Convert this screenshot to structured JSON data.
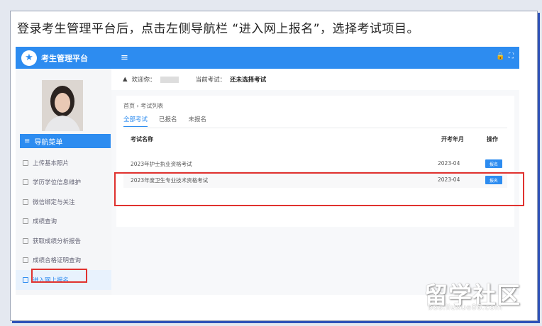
{
  "caption": "登录考生管理平台后，点击左侧导航栏 “进入网上报名”，选择考试项目。",
  "app": {
    "brand_title": "考生管理平台",
    "logo_glyph": "★",
    "menu_icon": "≡"
  },
  "topbar_icons": [
    "lock-icon",
    "expand-icon",
    "user-icon"
  ],
  "sidebar": {
    "nav_header": "导航菜单",
    "items": [
      {
        "label": "上传基本照片",
        "icon": "image-icon"
      },
      {
        "label": "学历学位信息维护",
        "icon": "doc-icon"
      },
      {
        "label": "微信绑定与关注",
        "icon": "link-icon"
      },
      {
        "label": "成绩查询",
        "icon": "search-icon"
      },
      {
        "label": "获取成绩分析报告",
        "icon": "report-icon"
      },
      {
        "label": "成绩合格证明查询",
        "icon": "file-icon"
      },
      {
        "label": "进入网上报名",
        "icon": "arrow-icon",
        "active": true
      }
    ]
  },
  "welcome": {
    "greeting": "欢迎你：",
    "current_exam_label": "当前考试：",
    "current_exam_value": "还未选择考试"
  },
  "breadcrumb": {
    "home": "首页",
    "sep": "›",
    "current": "考试列表"
  },
  "tabs": [
    "全部考试",
    "已报名",
    "未报名"
  ],
  "table": {
    "headers": {
      "name": "考试名称",
      "date": "开考年月",
      "op": "操作"
    },
    "rows": [
      {
        "name": "2023年护士执业资格考试",
        "date": "2023-04",
        "op": "报名"
      },
      {
        "name": "2023年度卫生专业技术资格考试",
        "date": "2023-04",
        "op": "报名"
      }
    ]
  },
  "watermark": {
    "text": "留学社区",
    "url": "bbs.liuxue86.com"
  },
  "colors": {
    "accent": "#2d8cf0",
    "highlight": "#e0322f"
  }
}
